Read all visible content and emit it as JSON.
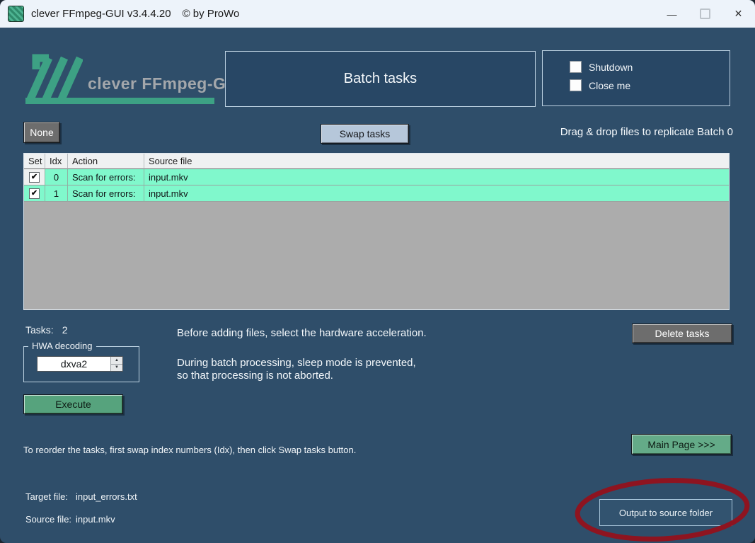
{
  "window": {
    "title": "clever FFmpeg-GUI v3.4.4.20",
    "copyright": "© by ProWo"
  },
  "icons": {
    "check": "✔",
    "minimize": "—",
    "close": "✕",
    "spinner_up": "▲",
    "spinner_down": "▼"
  },
  "header": {
    "logo_text": "clever FFmpeg-GUI",
    "page_title": "Batch tasks",
    "shutdown": "Shutdown",
    "close_me": "Close me"
  },
  "toolbar": {
    "none": "None",
    "swap_tasks": "Swap tasks",
    "drag_hint": "Drag & drop files to replicate Batch 0"
  },
  "table": {
    "columns": [
      "Set",
      "Idx",
      "Action",
      "Source file"
    ],
    "rows": [
      {
        "checked": true,
        "idx": "0",
        "action": "Scan for errors:",
        "source": "input.mkv"
      },
      {
        "checked": true,
        "idx": "1",
        "action": "Scan for errors:",
        "source": "input.mkv"
      }
    ]
  },
  "left": {
    "tasks_label": "Tasks:",
    "tasks_value": "2",
    "hwa_label": "HWA decoding",
    "hwa_value": "dxva2",
    "execute": "Execute"
  },
  "messages": {
    "line1": "Before adding files, select the hardware acceleration.",
    "line2": "During batch processing, sleep mode is prevented,",
    "line3": "so that processing is not aborted.",
    "reorder": "To reorder the tasks, first swap index numbers (Idx), then click Swap tasks button."
  },
  "actions": {
    "delete_tasks": "Delete tasks",
    "main_page": "Main Page >>>",
    "output_folder": "Output to source folder"
  },
  "footer": {
    "target_label": "Target file:",
    "target_value": "input_errors.txt",
    "source_label": "Source file:",
    "source_value": "input.mkv"
  },
  "colors": {
    "window_bg": "#2f4e6a",
    "panel_bg": "#284765",
    "titlebar_bg": "#edf3fa",
    "logo_green": "#3da184",
    "row_green": "#80f8cc",
    "table_gray": "#acacac",
    "button_gray": "#6d6d6d",
    "swap_blue": "#b6c7da",
    "execute_green": "#56a37d",
    "mainpage_green": "#64ab88",
    "annotation_red": "#8e1420"
  }
}
